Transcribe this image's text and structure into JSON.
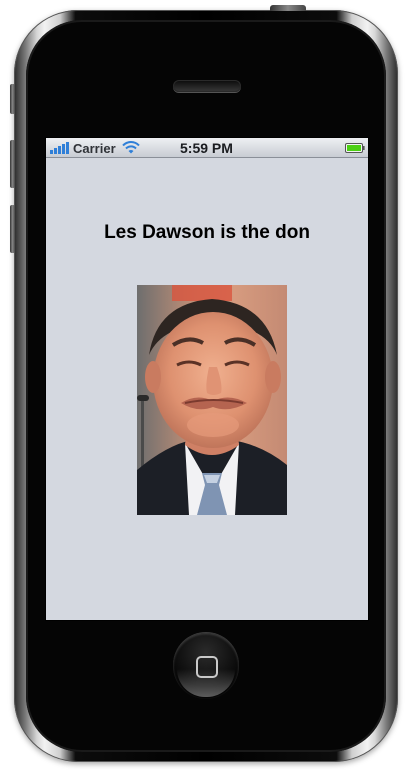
{
  "status_bar": {
    "carrier": "Carrier",
    "time": "5:59 PM",
    "signal_bars": 5,
    "battery_level": 1.0
  },
  "content": {
    "headline": "Les Dawson is the don"
  },
  "colors": {
    "screen_background": "#d4d8e0",
    "battery_fill": "#4cd015",
    "signal_color": "#2f7fd8"
  },
  "icons": {
    "signal": "signal-bars-icon",
    "wifi": "wifi-icon",
    "battery": "battery-icon",
    "home": "home-square-icon"
  }
}
